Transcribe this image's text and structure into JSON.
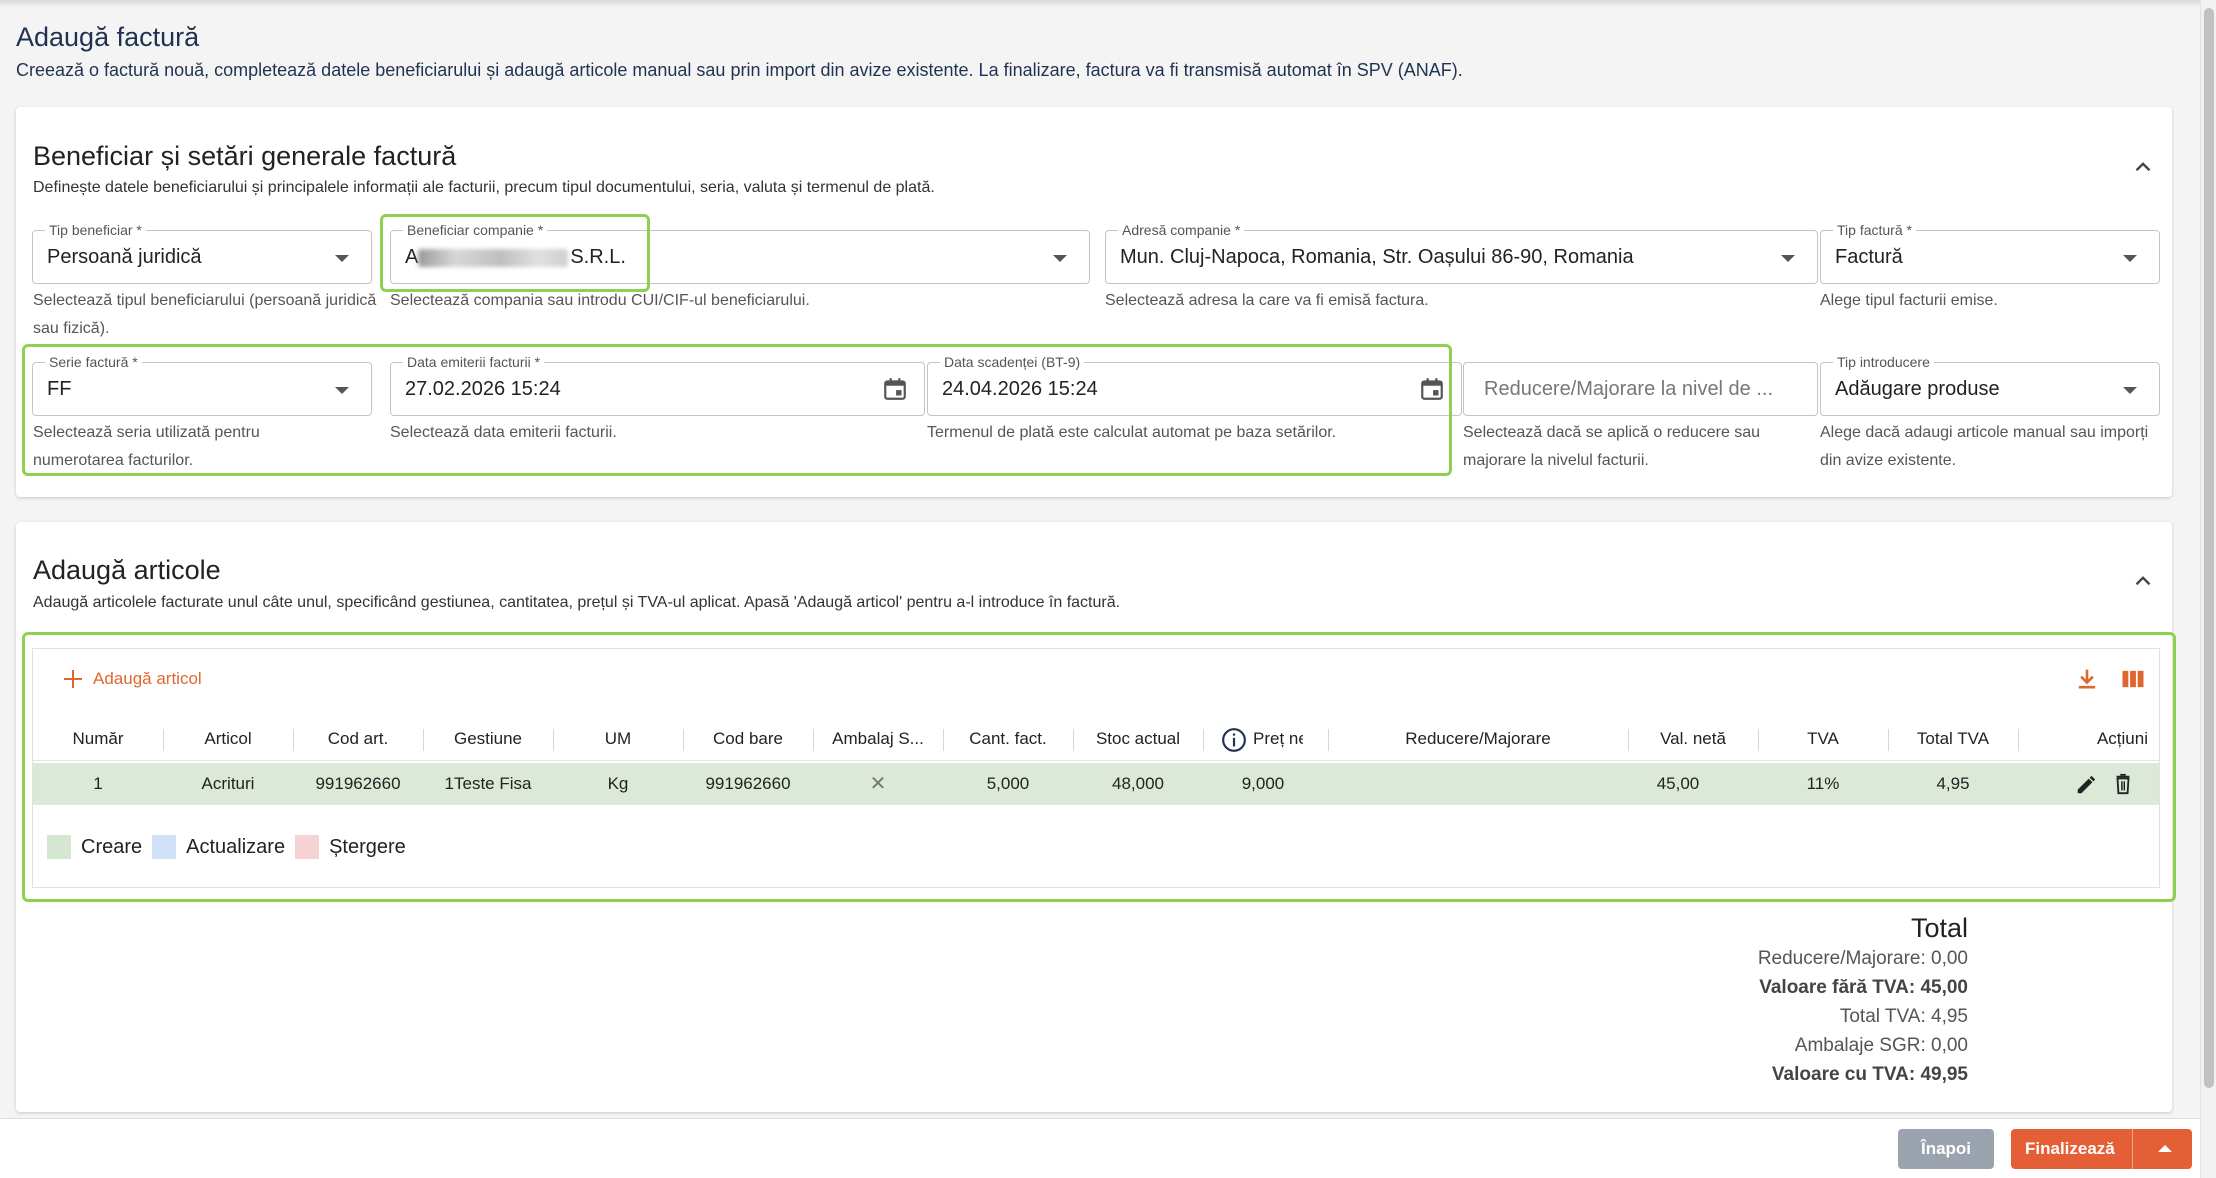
{
  "page": {
    "title": "Adaugă factură",
    "subtitle": "Creează o factură nouă, completează datele beneficiarului și adaugă articole manual sau prin import din avize existente. La finalizare, factura va fi transmisă automat în SPV (ANAF)."
  },
  "section1": {
    "title": "Beneficiar și setări generale factură",
    "description": "Definește datele beneficiarului și principalele informații ale facturii, precum tipul documentului, seria, valuta și termenul de plată.",
    "fields": {
      "tip_beneficiar": {
        "label": "Tip beneficiar *",
        "value": "Persoană juridică",
        "helper": "Selectează tipul beneficiarului (persoană juridică sau fizică)."
      },
      "beneficiar_companie": {
        "label": "Beneficiar companie *",
        "value_prefix": "A",
        "value_suffix": "S.R.L.",
        "helper": "Selectează compania sau introdu CUI/CIF-ul beneficiarului."
      },
      "adresa_companie": {
        "label": "Adresă companie *",
        "value": "Mun. Cluj-Napoca, Romania, Str. Oașului 86-90, Romania",
        "helper": "Selectează adresa la care va fi emisă factura."
      },
      "tip_factura": {
        "label": "Tip factură *",
        "value": "Factură",
        "helper": "Alege tipul facturii emise."
      },
      "serie_factura": {
        "label": "Serie factură *",
        "value": "FF",
        "helper": "Selectează seria utilizată pentru numerotarea facturilor."
      },
      "data_emiterii": {
        "label": "Data emiterii facturii *",
        "value": "27.02.2026 15:24",
        "helper": "Selectează data emiterii facturii."
      },
      "data_scadentei": {
        "label": "Data scadenței (BT-9)",
        "value": "24.04.2026 15:24",
        "helper": "Termenul de plată este calculat automat pe baza setărilor."
      },
      "reducere": {
        "placeholder": "Reducere/Majorare la nivel de ...",
        "helper": "Selectează dacă se aplică o reducere sau majorare la nivelul facturii."
      },
      "tip_introducere": {
        "label": "Tip introducere",
        "value": "Adăugare produse",
        "helper": "Alege dacă adaugi articole manual sau imporți din avize existente."
      }
    }
  },
  "section2": {
    "title": "Adaugă articole",
    "description": "Adaugă articolele facturate unul câte unul, specificând gestiunea, cantitatea, prețul și TVA-ul aplicat. Apasă 'Adaugă articol' pentru a-l introduce în factură.",
    "add_label": "Adaugă articol",
    "columns": [
      "Număr",
      "Articol",
      "Cod art.",
      "Gestiune",
      "UM",
      "Cod bare",
      "Ambalaj S...",
      "Cant. fact.",
      "Stoc actual",
      "Preț ne",
      "Reducere/Majorare",
      "Val. netă",
      "TVA",
      "Total TVA",
      "Acțiuni"
    ],
    "rows": [
      {
        "numar": "1",
        "articol": "Acrituri",
        "cod_art": "991962660",
        "gestiune": "1Teste Fisa",
        "um": "Kg",
        "cod_bare": "991962660",
        "ambalaj": "✕",
        "cant": "5,000",
        "stoc": "48,000",
        "pret": "9,000",
        "reducere": "",
        "val_neta": "45,00",
        "tva": "11%",
        "total_tva": "4,95"
      }
    ],
    "legend": [
      {
        "label": "Creare",
        "color": "#d5e6d1"
      },
      {
        "label": "Actualizare",
        "color": "#cfe0f7"
      },
      {
        "label": "Ștergere",
        "color": "#f7d2d3"
      }
    ]
  },
  "totals": {
    "title": "Total",
    "reducere": "Reducere/Majorare: 0,00",
    "fara_tva": "Valoare fără TVA: 45,00",
    "total_tva": "Total TVA: 4,95",
    "ambalaje": "Ambalaje SGR: 0,00",
    "cu_tva": "Valoare cu TVA: 49,95"
  },
  "footer": {
    "back_label": "Înapoi",
    "finalize_label": "Finalizează"
  },
  "colors": {
    "accent": "#e55f36",
    "highlight": "#8fd14f",
    "title": "#1f3350"
  }
}
